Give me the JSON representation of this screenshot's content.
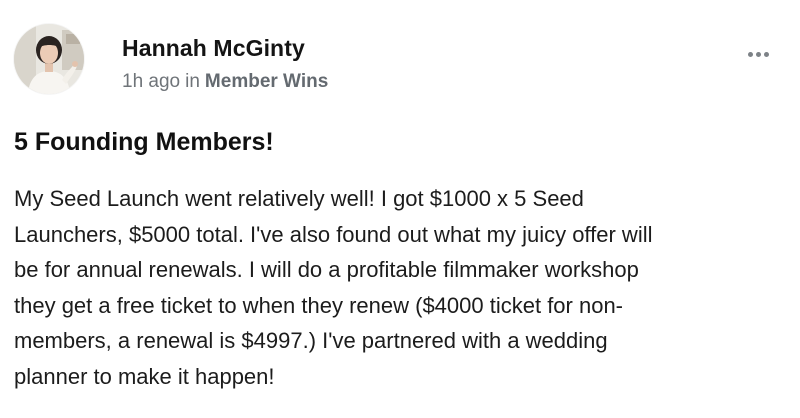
{
  "post": {
    "author": {
      "name": "Hannah McGinty",
      "avatar_icon": "profile-photo"
    },
    "timestamp": "1h ago",
    "in_label": "in",
    "space": "Member Wins",
    "more_icon": "ellipsis-horizontal-icon",
    "title": "5 Founding Members!",
    "body_lines": [
      "My Seed Launch went relatively well! I got $1000 x 5 Seed",
      "Launchers, $5000 total. I've also found out what my juicy offer will",
      "be for annual renewals. I will do a profitable filmmaker workshop",
      "they get a free ticket to when they renew ($4000 ticket for non-",
      "members, a renewal is $4997.) I've partnered with a wedding",
      "planner to make it happen!"
    ]
  },
  "colors": {
    "text_primary": "#141414",
    "text_meta": "#6f7479",
    "background": "#ffffff"
  }
}
